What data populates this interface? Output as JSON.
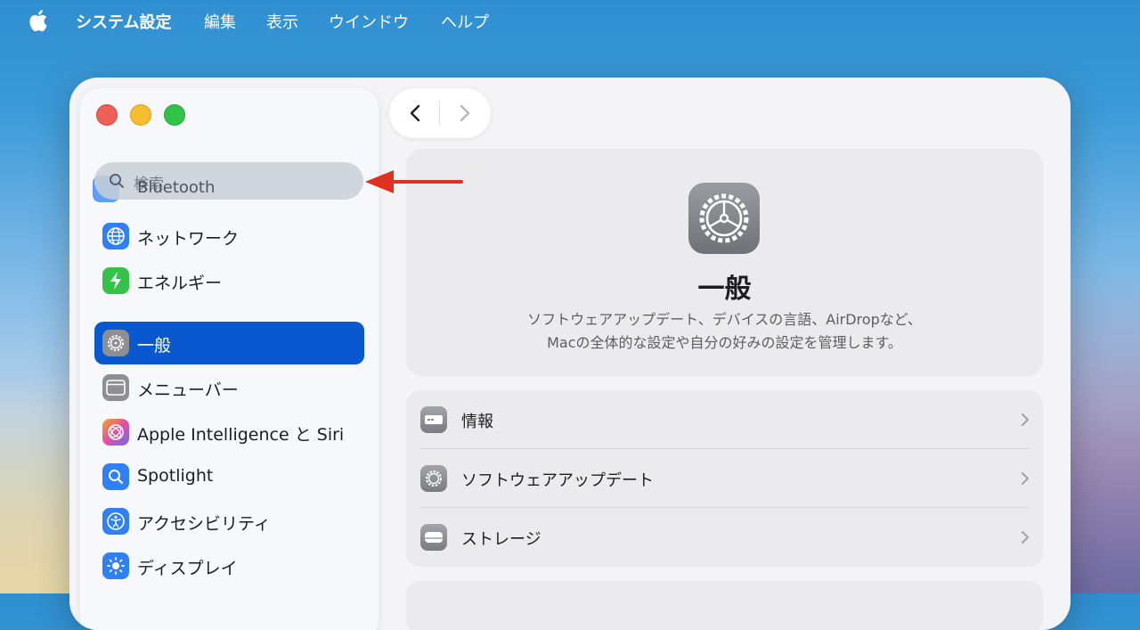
{
  "menubar": {
    "app_name": "システム設定",
    "items": [
      "編集",
      "表示",
      "ウインドウ",
      "ヘルプ"
    ]
  },
  "sidebar": {
    "search_placeholder": "検索",
    "overlap_label": "Bluetooth",
    "items": [
      {
        "label": "ネットワーク",
        "icon": "globe-icon",
        "color": "#2f7ff5"
      },
      {
        "label": "エネルギー",
        "icon": "bolt-icon",
        "color": "#35c24a"
      },
      {
        "label": "一般",
        "icon": "gear-icon",
        "color": "#8e8e93",
        "selected": true
      },
      {
        "label": "メニューバー",
        "icon": "menubar-icon",
        "color": "#8e8e93"
      },
      {
        "label": "Apple Intelligence と Siri",
        "icon": "siri-icon",
        "color": "#c86fe0"
      },
      {
        "label": "Spotlight",
        "icon": "spotlight-icon",
        "color": "#2f7ff5"
      },
      {
        "label": "アクセシビリティ",
        "icon": "accessibility-icon",
        "color": "#2f7ff5"
      },
      {
        "label": "ディスプレイ",
        "icon": "brightness-icon",
        "color": "#2f7ff5"
      }
    ]
  },
  "main": {
    "title": "一般",
    "description_line1": "ソフトウェアアップデート、デバイスの言語、AirDropなど、",
    "description_line2": "Macの全体的な設定や自分の好みの設定を管理します。",
    "rows": [
      {
        "label": "情報",
        "icon": "info-icon"
      },
      {
        "label": "ソフトウェアアップデート",
        "icon": "gear-icon"
      },
      {
        "label": "ストレージ",
        "icon": "storage-icon"
      }
    ]
  },
  "colors": {
    "selection": "#0a58d0",
    "annotation_arrow": "#e03020"
  }
}
